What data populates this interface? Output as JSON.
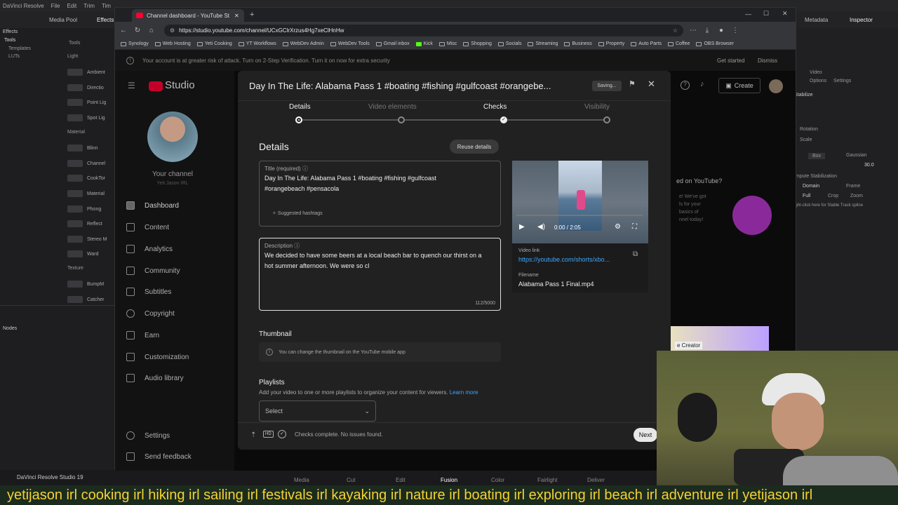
{
  "davinci": {
    "menu": [
      "DaVinci Resolve",
      "File",
      "Edit",
      "Trim",
      "Tim"
    ],
    "top_tabs": [
      "Media Pool",
      "Effects"
    ],
    "right_tabs": [
      "Metadata",
      "Inspector"
    ],
    "left_panel": {
      "effects": "Effects",
      "tools": "Tools",
      "templates": "Templates",
      "luts": "LUTs",
      "tools_header": "Tools",
      "light": "Light",
      "light_items": [
        "Ambient",
        "Directio",
        "Point Lig",
        "Spot Lig"
      ],
      "material": "Material",
      "material_items": [
        "Blinn",
        "Channel",
        "CookTor",
        "Material",
        "Phong",
        "Reflect",
        "Stereo M",
        "Ward"
      ],
      "texture": "Texture",
      "texture_items": [
        "BumpM",
        "Catcher"
      ],
      "nodes": "Nodes"
    },
    "bottom": {
      "brand": "DaVinci Resolve Studio 19",
      "pages": [
        "Media",
        "Cut",
        "Edit",
        "Fusion",
        "Color",
        "Fairlight",
        "Deliver"
      ],
      "active_page": "Fusion"
    },
    "inspector": {
      "tabs": [
        "Video",
        "Options",
        "Settings"
      ],
      "stabilize": "Stabilize",
      "rows": [
        "Rotation",
        "Scale"
      ],
      "box": "Box",
      "gaussian": "Gaussian",
      "value": "30.0",
      "compute": "ompute Stabilization",
      "domain": "Domain",
      "frame": "Frame",
      "full": "Full",
      "crop": "Crop",
      "zoom": "Zoom",
      "hint": "ight-click here for Stable Track spline"
    },
    "behind": {
      "promo_title": "ed on YouTube?",
      "promo_lines": [
        "e! We've got",
        "ls for your",
        "basics of",
        "nnel today!"
      ],
      "creator": "e Creator"
    }
  },
  "browser": {
    "tab_title": "Channel dashboard - YouTube St",
    "url": "https://studio.youtube.com/channel/UCxGClrXrzus4Hg7xeClHnHw",
    "bookmarks": [
      "Synology",
      "Web Hosting",
      "Yeti Cooking",
      "YT Workflows",
      "WebDev Admin",
      "WebDev Tools",
      "Gmail inbox",
      "Kick",
      "Misc",
      "Shopping",
      "Socials",
      "Streaming",
      "Business",
      "Property",
      "Auto Parts",
      "Coffee",
      "OBS Browser"
    ],
    "banner": {
      "text": "Your account is at greater risk of attack. Turn on 2-Step Verification. Turn it on now for extra security",
      "get_started": "Get started",
      "dismiss": "Dismiss"
    }
  },
  "studio": {
    "logo": "Studio",
    "create": "Create",
    "channel_label": "Your channel",
    "channel_name": "Yeti Jason IRL",
    "nav": [
      "Dashboard",
      "Content",
      "Analytics",
      "Community",
      "Subtitles",
      "Copyright",
      "Earn",
      "Customization",
      "Audio library"
    ],
    "bottom_nav": [
      "Settings",
      "Send feedback"
    ]
  },
  "dialog": {
    "title": "Day In The Life: Alabama Pass 1 #boating #fishing #gulfcoast #orangebe...",
    "saving": "Saving...",
    "steps": [
      "Details",
      "Video elements",
      "Checks",
      "Visibility"
    ],
    "section": "Details",
    "reuse": "Reuse details",
    "title_label": "Title (required)",
    "title_value_1": "Day In The Life: Alabama Pass 1 #boating #fishing  #gulfcoast",
    "title_value_2": "#orangebeach #pensacola",
    "suggested": "Suggested hashtags",
    "desc_label": "Description",
    "desc_value_1": "We decided to have some beers at a local beach bar to quench our thirst on a",
    "desc_value_2": "hot summer afternoon. We were so cl",
    "desc_count": "112/5000",
    "video": {
      "time": "0:00 / 2:05",
      "link_label": "Video link",
      "link": "https://youtube.com/shorts/xbo...",
      "filename_label": "Filename",
      "filename": "Alabama Pass 1 Final.mp4"
    },
    "thumbnail_title": "Thumbnail",
    "thumbnail_info": "You can change the thumbnail on the YouTube mobile app",
    "playlists_title": "Playlists",
    "playlists_desc": "Add your video to one or more playlists to organize your content for viewers.",
    "learn_more": "Learn more",
    "select": "Select",
    "status": "Checks complete. No issues found.",
    "hd": "HD",
    "next": "Next"
  },
  "ticker": "yetijason irl cooking irl hiking irl sailing irl festivals irl kayaking irl nature irl boating irl exploring irl beach irl adventure irl yetijason irl"
}
